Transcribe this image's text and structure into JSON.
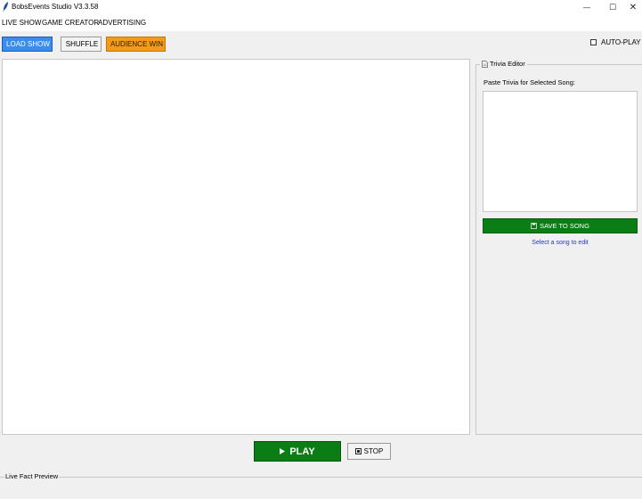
{
  "window": {
    "title": "BobsEvents Studio V3.3.58",
    "controls": {
      "minimize": "—",
      "maximize": "☐",
      "close": "✕"
    }
  },
  "tabs": [
    {
      "label": "LIVE SHOW",
      "active": true
    },
    {
      "label": "GAME CREATOR",
      "active": false
    },
    {
      "label": "ADVERTISING",
      "active": false
    }
  ],
  "toolbar": {
    "load_show": {
      "label": "LOAD SHOW",
      "icon": "folder-icon",
      "color": "#3b8ded"
    },
    "shuffle": {
      "label": "SHUFFLE",
      "icon": "shuffle-icon"
    },
    "audience_win": {
      "label": "AUDIENCE WIN",
      "icon": "star-icon",
      "color": "#f39a1b"
    },
    "auto_play": {
      "label": "AUTO-PLAY",
      "checked": false
    }
  },
  "trivia_editor": {
    "title": "Trivia Editor",
    "prompt": "Paste Trivia for Selected Song:",
    "text_value": "",
    "save_button": {
      "label": "SAVE TO SONG",
      "icon": "save-icon",
      "color": "#0a7d14"
    },
    "hint": "Select a song to edit",
    "hint_color": "#2833d6"
  },
  "playback": {
    "play": {
      "label": "PLAY",
      "icon": "play-icon",
      "color": "#0a7d14"
    },
    "stop": {
      "label": "STOP",
      "icon": "stop-icon"
    }
  },
  "live_fact_preview": {
    "title": "Live Fact Preview"
  }
}
